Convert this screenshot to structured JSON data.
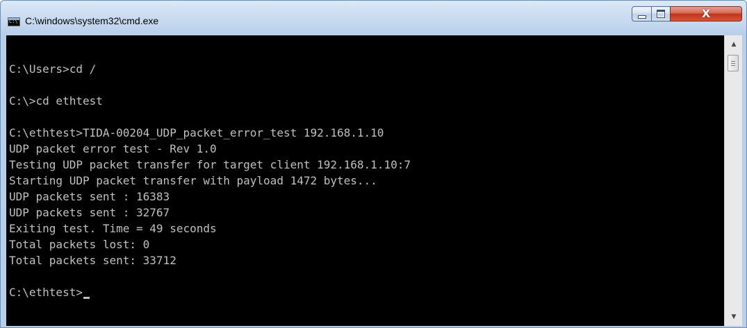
{
  "window": {
    "title": "C:\\windows\\system32\\cmd.exe",
    "icon": "cmd-icon",
    "controls": {
      "minimize_icon": "minimize-icon",
      "maximize_icon": "maximize-icon",
      "close_icon": "close-icon",
      "close_glyph": "X"
    }
  },
  "console": {
    "background": "#000000",
    "text_color": "#c0c0c0",
    "lines": [
      "C:\\Users>cd /",
      "",
      "C:\\>cd ethtest",
      "",
      "C:\\ethtest>TIDA-00204_UDP_packet_error_test 192.168.1.10",
      "UDP packet error test - Rev 1.0",
      "Testing UDP packet transfer for target client 192.168.1.10:7",
      "Starting UDP packet transfer with payload 1472 bytes...",
      "UDP packets sent : 16383",
      "UDP packets sent : 32767",
      "Exiting test. Time = 49 seconds",
      "Total packets lost: 0",
      "Total packets sent: 33712",
      "",
      "C:\\ethtest>"
    ]
  },
  "scrollbar": {
    "up_icon": "scroll-up-arrow-icon",
    "down_icon": "scroll-down-arrow-icon",
    "up_glyph": "▲",
    "down_glyph": "▼"
  }
}
